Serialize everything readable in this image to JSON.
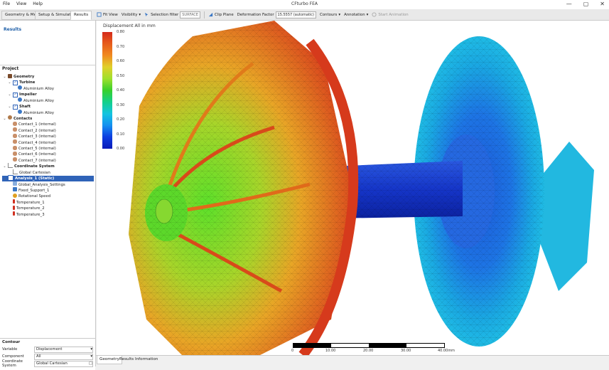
{
  "app": {
    "title": "CFturbo FEA",
    "menu": [
      "File",
      "View",
      "Help"
    ],
    "window_controls": {
      "minimize": "—",
      "maximize": "▢",
      "close": "✕"
    }
  },
  "tabs": [
    {
      "label": "Geometry & Mesh",
      "active": false
    },
    {
      "label": "Setup & Simulation",
      "active": false
    },
    {
      "label": "Results",
      "active": true
    }
  ],
  "toolbar": {
    "fit_view": "Fit View",
    "visibility": "Visibility",
    "selection_filter_label": "Selection filter",
    "selection_filter_value": "SURFACE",
    "clip_plane": "Clip Plane",
    "deformation_label": "Deformation Factor",
    "deformation_value": "15.5557 (automatic)",
    "contours": "Contours",
    "annotation": "Annotation",
    "start_animation": "Start Animation"
  },
  "left": {
    "results_heading": "Results",
    "project_label": "Project",
    "tree": [
      {
        "label": "Geometry",
        "level": 0,
        "bold": true,
        "icon": "geometry-icon",
        "color": "#7a4a2a"
      },
      {
        "label": "Turbine",
        "level": 1,
        "bold": true,
        "icon": "checkbox-icon",
        "color": "#2f63b8"
      },
      {
        "label": "Aluminium Alloy",
        "level": 2,
        "bold": false,
        "icon": "material-icon",
        "color": "#3b78c6"
      },
      {
        "label": "Impeller",
        "level": 1,
        "bold": true,
        "icon": "checkbox-icon",
        "color": "#2f63b8"
      },
      {
        "label": "Aluminium Alloy",
        "level": 2,
        "bold": false,
        "icon": "material-icon",
        "color": "#3b78c6"
      },
      {
        "label": "Shaft",
        "level": 1,
        "bold": true,
        "icon": "checkbox-icon",
        "color": "#2f63b8"
      },
      {
        "label": "Aluminium Alloy",
        "level": 2,
        "bold": false,
        "icon": "material-icon",
        "color": "#3b78c6"
      },
      {
        "label": "Contacts",
        "level": 0,
        "bold": true,
        "icon": "contacts-icon",
        "color": "#b07a4a"
      },
      {
        "label": "Contact_1 (internal)",
        "level": 1,
        "bold": false,
        "icon": "contact-icon",
        "color": "#c9906a"
      },
      {
        "label": "Contact_2 (internal)",
        "level": 1,
        "bold": false,
        "icon": "contact-icon",
        "color": "#c9906a"
      },
      {
        "label": "Contact_3 (internal)",
        "level": 1,
        "bold": false,
        "icon": "contact-icon",
        "color": "#c9906a"
      },
      {
        "label": "Contact_4 (internal)",
        "level": 1,
        "bold": false,
        "icon": "contact-icon",
        "color": "#c9906a"
      },
      {
        "label": "Contact_5 (internal)",
        "level": 1,
        "bold": false,
        "icon": "contact-icon",
        "color": "#c9906a"
      },
      {
        "label": "Contact_6 (internal)",
        "level": 1,
        "bold": false,
        "icon": "contact-icon",
        "color": "#c9906a"
      },
      {
        "label": "Contact_7 (internal)",
        "level": 1,
        "bold": false,
        "icon": "contact-icon",
        "color": "#c9906a"
      },
      {
        "label": "Coordinate System",
        "level": 0,
        "bold": true,
        "icon": "axes-icon",
        "color": "#888888"
      },
      {
        "label": "Global Cartesian",
        "level": 1,
        "bold": false,
        "icon": "axes-icon",
        "color": "#888888"
      },
      {
        "label": "Analysis_1 (Static)",
        "level": 0,
        "bold": true,
        "icon": "analysis-icon",
        "color": "#2f63b8",
        "selected": true
      },
      {
        "label": "Global_Analysis_Settings",
        "level": 1,
        "bold": false,
        "icon": "settings-icon",
        "color": "#3b78c6"
      },
      {
        "label": "Fixed_Support_1",
        "level": 1,
        "bold": false,
        "icon": "support-icon",
        "color": "#3b78c6"
      },
      {
        "label": "Rotational Speed",
        "level": 1,
        "bold": false,
        "icon": "rotation-icon",
        "color": "#e0a020"
      },
      {
        "label": "Temperature_1",
        "level": 1,
        "bold": false,
        "icon": "thermometer-icon",
        "color": "#d03020"
      },
      {
        "label": "Temperature_2",
        "level": 1,
        "bold": false,
        "icon": "thermometer-icon",
        "color": "#d03020"
      },
      {
        "label": "Temperature_3",
        "level": 1,
        "bold": false,
        "icon": "thermometer-icon",
        "color": "#d03020"
      }
    ]
  },
  "contour": {
    "title": "Contour",
    "variable_label": "Variable",
    "variable_value": "Displacement",
    "component_label": "Component",
    "component_value": "All",
    "coord_label": "Coordinate System",
    "coord_value": "Global Cartesian"
  },
  "legend": {
    "title": "Displacement All in mm",
    "ticks": [
      "0.80",
      "0.70",
      "0.60",
      "0.50",
      "0.40",
      "0.30",
      "0.20",
      "0.10",
      "0.00"
    ]
  },
  "scale": {
    "labels": [
      "0",
      "10.00",
      "20.00",
      "30.00",
      "40.00mm"
    ]
  },
  "bottom_tabs": [
    {
      "label": "Geometry",
      "active": true
    },
    {
      "label": "Results Information",
      "active": false
    }
  ]
}
